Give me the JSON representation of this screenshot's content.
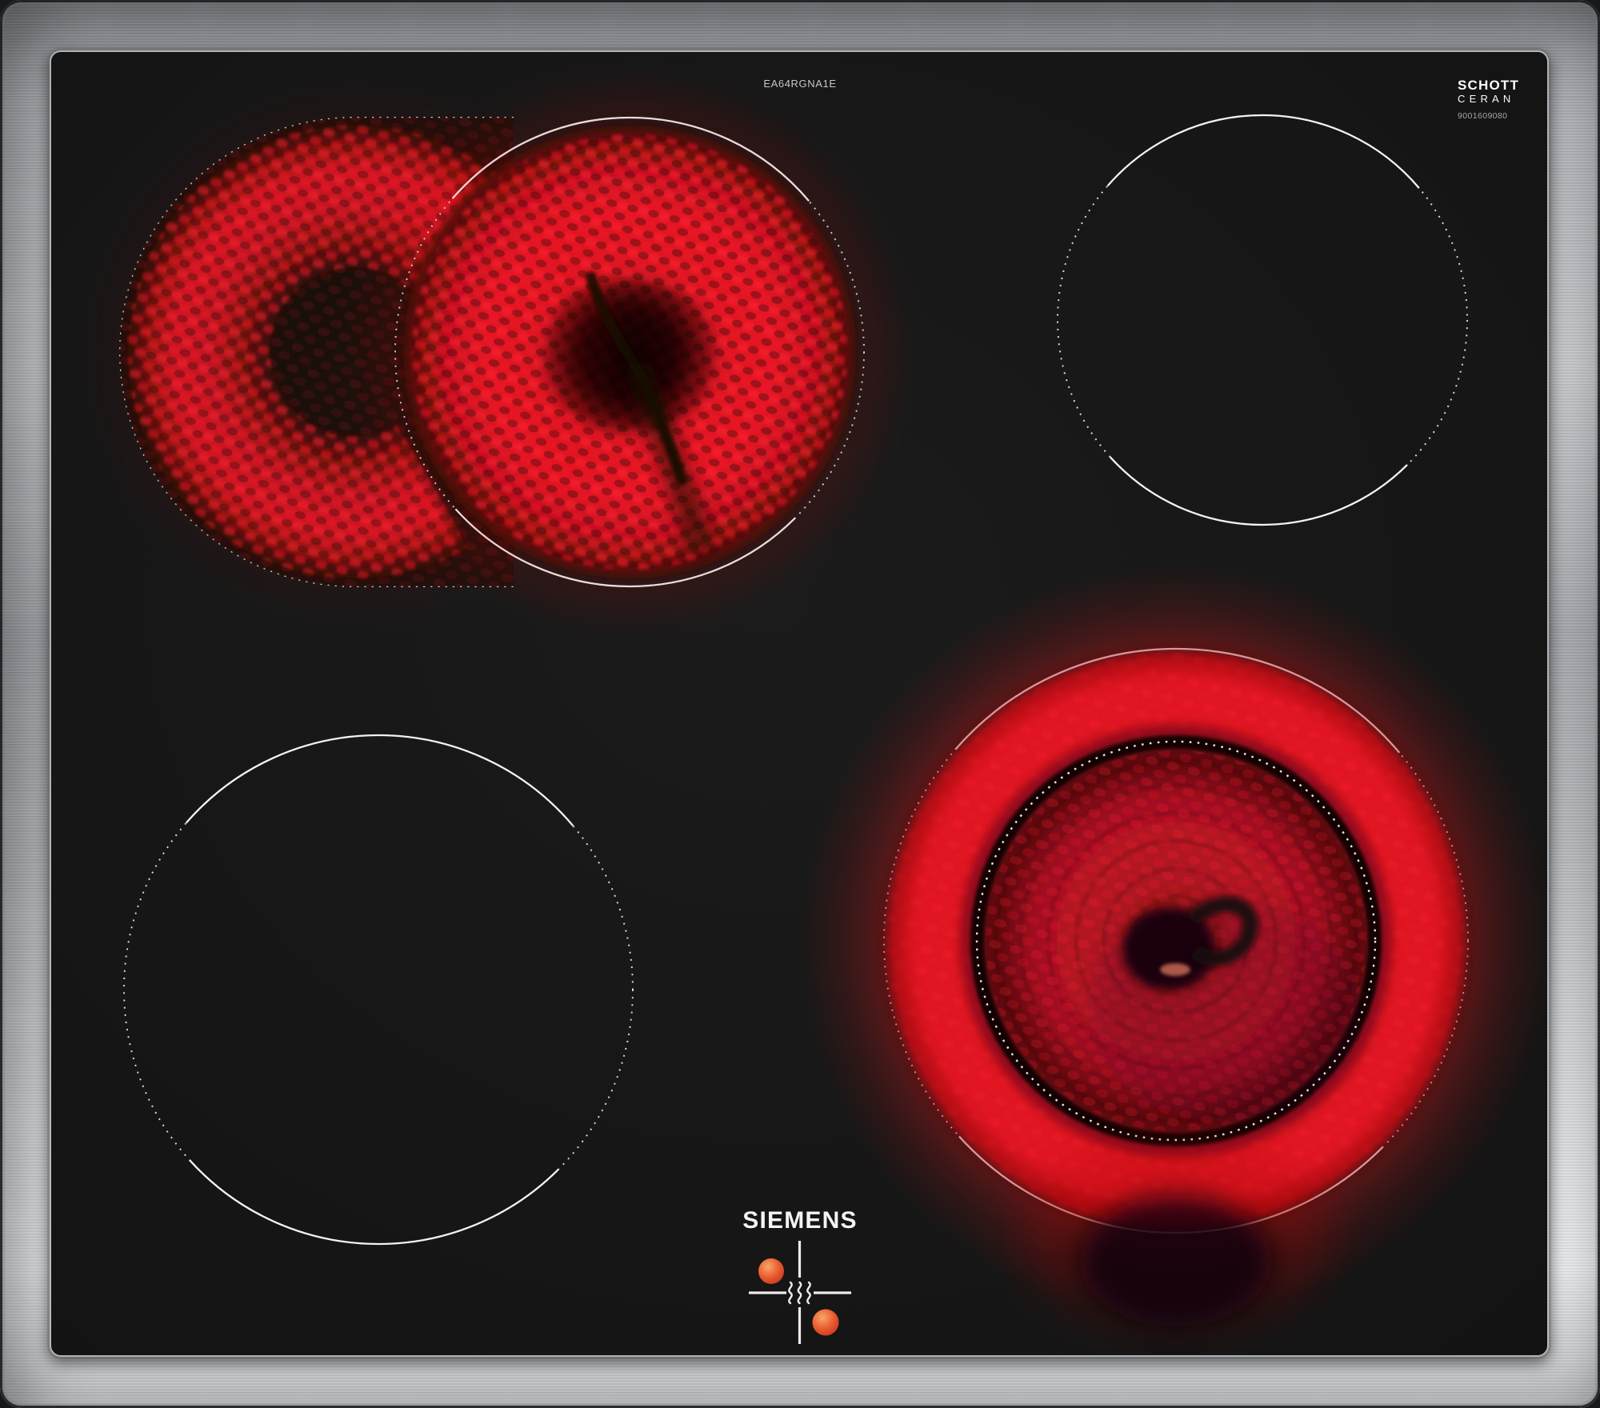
{
  "branding": {
    "model_code": "EA64RGNA1E",
    "brand_logo": "SIEMENS",
    "glass_brand_line1": "SCHOTT",
    "glass_brand_line2": "CERAN",
    "glass_serial": "9001609080"
  },
  "colors": {
    "steel_frame": "#b9bcc0",
    "glass_black": "#141414",
    "glow_bright_red": "#e81425",
    "glow_deep_red": "#8c120f",
    "dark_ring": "#0b0405",
    "zone_outline_white": "#e6e6e6",
    "residual_heat_dot": "#e2512b"
  },
  "zones": {
    "rear_left": {
      "type": "dual-extension radiant zone",
      "state": "on"
    },
    "rear_right": {
      "type": "radiant zone",
      "state": "off"
    },
    "front_left": {
      "type": "radiant zone",
      "state": "off"
    },
    "front_right": {
      "type": "dual-ring radiant zone",
      "state": "on"
    }
  }
}
